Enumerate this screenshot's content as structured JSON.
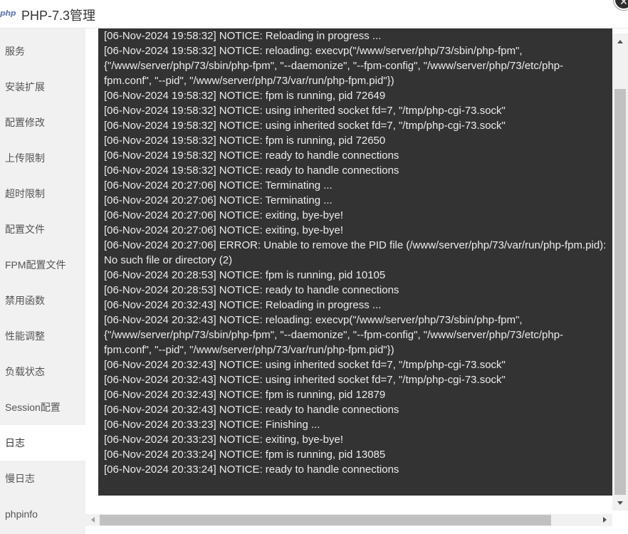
{
  "window": {
    "logo_text": "php",
    "title": "PHP-7.3管理",
    "close_symbol": "✕"
  },
  "sidebar": {
    "active_index": 11,
    "items": [
      {
        "label": "服务"
      },
      {
        "label": "安装扩展"
      },
      {
        "label": "配置修改"
      },
      {
        "label": "上传限制"
      },
      {
        "label": "超时限制"
      },
      {
        "label": "配置文件"
      },
      {
        "label": "FPM配置文件"
      },
      {
        "label": "禁用函数"
      },
      {
        "label": "性能调整"
      },
      {
        "label": "负载状态"
      },
      {
        "label": "Session配置"
      },
      {
        "label": "日志"
      },
      {
        "label": "慢日志"
      },
      {
        "label": "phpinfo"
      }
    ]
  },
  "log": {
    "lines": [
      "[06-Nov-2024 19:58:32] NOTICE: Reloading in progress ...",
      "[06-Nov-2024 19:58:32] NOTICE: reloading: execvp(\"/www/server/php/73/sbin/php-fpm\",",
      "{\"/www/server/php/73/sbin/php-fpm\", \"--daemonize\", \"--fpm-config\", \"/www/server/php/73/etc/php-",
      "fpm.conf\", \"--pid\", \"/www/server/php/73/var/run/php-fpm.pid\"})",
      "[06-Nov-2024 19:58:32] NOTICE: fpm is running, pid 72649",
      "[06-Nov-2024 19:58:32] NOTICE: using inherited socket fd=7, \"/tmp/php-cgi-73.sock\"",
      "[06-Nov-2024 19:58:32] NOTICE: using inherited socket fd=7, \"/tmp/php-cgi-73.sock\"",
      "[06-Nov-2024 19:58:32] NOTICE: fpm is running, pid 72650",
      "[06-Nov-2024 19:58:32] NOTICE: ready to handle connections",
      "[06-Nov-2024 19:58:32] NOTICE: ready to handle connections",
      "[06-Nov-2024 20:27:06] NOTICE: Terminating ...",
      "[06-Nov-2024 20:27:06] NOTICE: Terminating ...",
      "[06-Nov-2024 20:27:06] NOTICE: exiting, bye-bye!",
      "[06-Nov-2024 20:27:06] NOTICE: exiting, bye-bye!",
      "[06-Nov-2024 20:27:06] ERROR: Unable to remove the PID file (/www/server/php/73/var/run/php-fpm.pid):",
      "No such file or directory (2)",
      "[06-Nov-2024 20:28:53] NOTICE: fpm is running, pid 10105",
      "[06-Nov-2024 20:28:53] NOTICE: ready to handle connections",
      "[06-Nov-2024 20:32:43] NOTICE: Reloading in progress ...",
      "[06-Nov-2024 20:32:43] NOTICE: reloading: execvp(\"/www/server/php/73/sbin/php-fpm\",",
      "{\"/www/server/php/73/sbin/php-fpm\", \"--daemonize\", \"--fpm-config\", \"/www/server/php/73/etc/php-",
      "fpm.conf\", \"--pid\", \"/www/server/php/73/var/run/php-fpm.pid\"})",
      "[06-Nov-2024 20:32:43] NOTICE: using inherited socket fd=7, \"/tmp/php-cgi-73.sock\"",
      "[06-Nov-2024 20:32:43] NOTICE: using inherited socket fd=7, \"/tmp/php-cgi-73.sock\"",
      "[06-Nov-2024 20:32:43] NOTICE: fpm is running, pid 12879",
      "[06-Nov-2024 20:32:43] NOTICE: ready to handle connections",
      "[06-Nov-2024 20:33:23] NOTICE: Finishing ...",
      "[06-Nov-2024 20:33:23] NOTICE: exiting, bye-bye!",
      "[06-Nov-2024 20:33:24] NOTICE: fpm is running, pid 13085",
      "[06-Nov-2024 20:33:24] NOTICE: ready to handle connections"
    ]
  },
  "colors": {
    "log_background": "#333333",
    "log_text": "#ececec",
    "sidebar_background": "#f1f1f1",
    "sidebar_active_background": "#ffffff"
  }
}
